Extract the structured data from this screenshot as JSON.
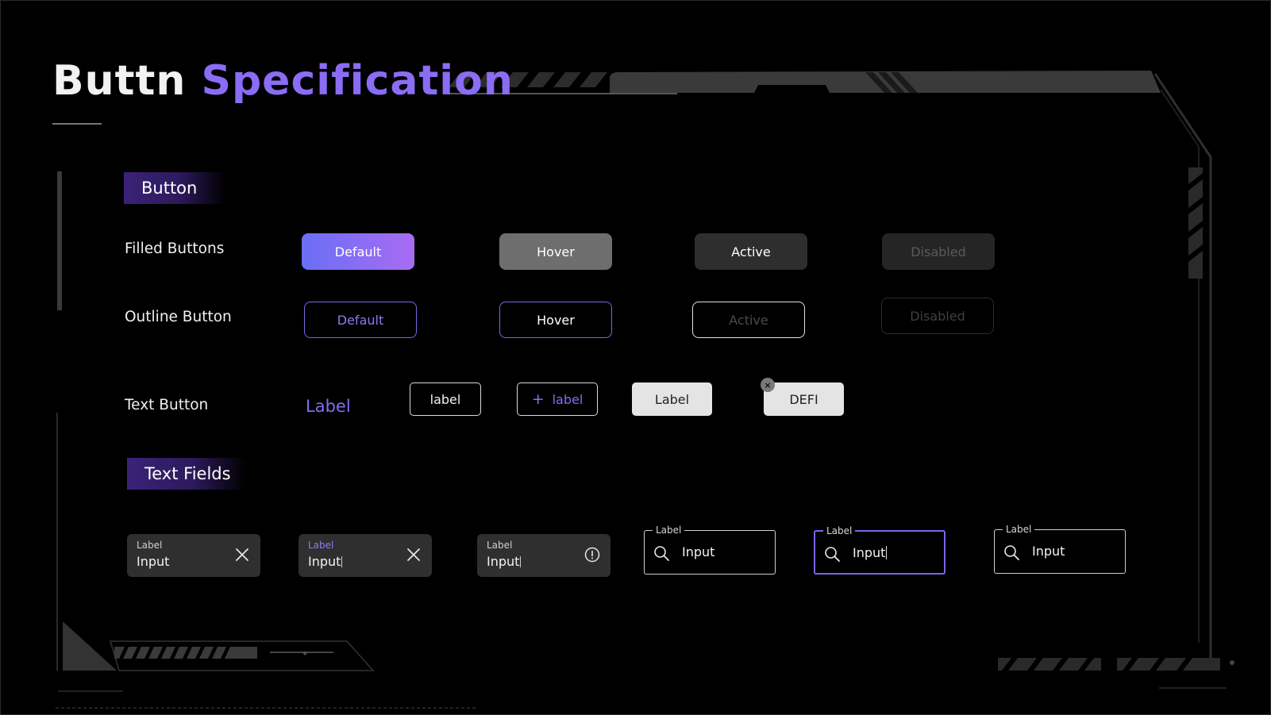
{
  "title": {
    "part1": "Buttn",
    "part2": "Specification"
  },
  "sections": {
    "button": "Button",
    "text_fields": "Text Fields"
  },
  "rows": {
    "filled": {
      "label": "Filled Buttons",
      "buttons": [
        "Default",
        "Hover",
        "Active",
        "Disabled"
      ]
    },
    "outline": {
      "label": "Outline Button",
      "buttons": [
        "Default",
        "Hover",
        "Active",
        "Disabled"
      ]
    },
    "text": {
      "label": "Text Button",
      "text_link": "Label",
      "outline_label": "label",
      "plus_label": "label",
      "plus_symbol": "+",
      "light_label": "Label",
      "chip_label": "DEFI",
      "chip_close_symbol": "×"
    }
  },
  "text_fields": {
    "filled": [
      {
        "label": "Label",
        "value": "Input",
        "trailing_icon": "close-icon"
      },
      {
        "label": "Label",
        "value": "Input",
        "trailing_icon": "close-icon"
      },
      {
        "label": "Label",
        "value": "Input",
        "trailing_icon": "info-icon"
      }
    ],
    "outlined": [
      {
        "label": "Label",
        "value": "Input",
        "leading_icon": "search-icon"
      },
      {
        "label": "Label",
        "value": "Input",
        "leading_icon": "search-icon"
      },
      {
        "label": "Label",
        "value": "Input",
        "leading_icon": "search-icon"
      }
    ]
  },
  "colors": {
    "accent": "#8b6cf5",
    "primary_gradient_start": "#6a6ef6",
    "primary_gradient_end": "#a86cf2",
    "background": "#000000"
  }
}
